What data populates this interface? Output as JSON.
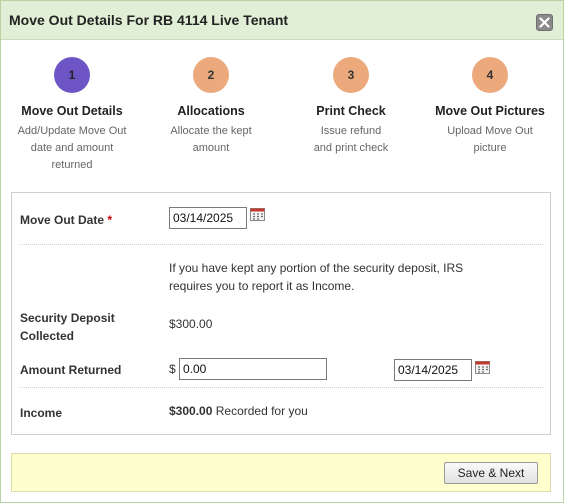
{
  "dialog": {
    "title": "Move Out Details For RB 4114 Live Tenant"
  },
  "steps": [
    {
      "number": "1",
      "title": "Move Out Details",
      "desc_lines": [
        "Add/Update Move Out",
        "date and amount",
        "returned"
      ],
      "active": true
    },
    {
      "number": "2",
      "title": "Allocations",
      "desc_lines": [
        "Allocate the kept",
        "amount"
      ],
      "active": false
    },
    {
      "number": "3",
      "title": "Print Check",
      "desc_lines": [
        "Issue refund",
        "and print check"
      ],
      "active": false
    },
    {
      "number": "4",
      "title": "Move Out Pictures",
      "desc_lines": [
        "Upload Move Out",
        "picture"
      ],
      "active": false
    }
  ],
  "form": {
    "move_out_date_label": "Move Out Date",
    "required_mark": "*",
    "move_out_date_value": "03/14/2025",
    "notice_line1": "If you have kept any portion of the security deposit, IRS",
    "notice_line2": "requires you to report it as Income.",
    "security_deposit_label_line1": "Security Deposit",
    "security_deposit_label_line2": "Collected",
    "security_deposit_value": "$300.00",
    "amount_returned_label": "Amount Returned",
    "currency_symbol": "$",
    "amount_returned_value": "0.00",
    "returned_date_value": "03/14/2025",
    "income_label": "Income",
    "income_amount": "$300.00",
    "income_note": "Recorded for you"
  },
  "footer": {
    "save_next_label": "Save & Next"
  },
  "colors": {
    "titlebar_bg": "#e0efd6",
    "active_step": "#6d55c6",
    "inactive_step": "#eba97c",
    "footer_bg": "#ffffce"
  },
  "icons": {
    "close": "close-icon",
    "calendar": "calendar-icon"
  }
}
